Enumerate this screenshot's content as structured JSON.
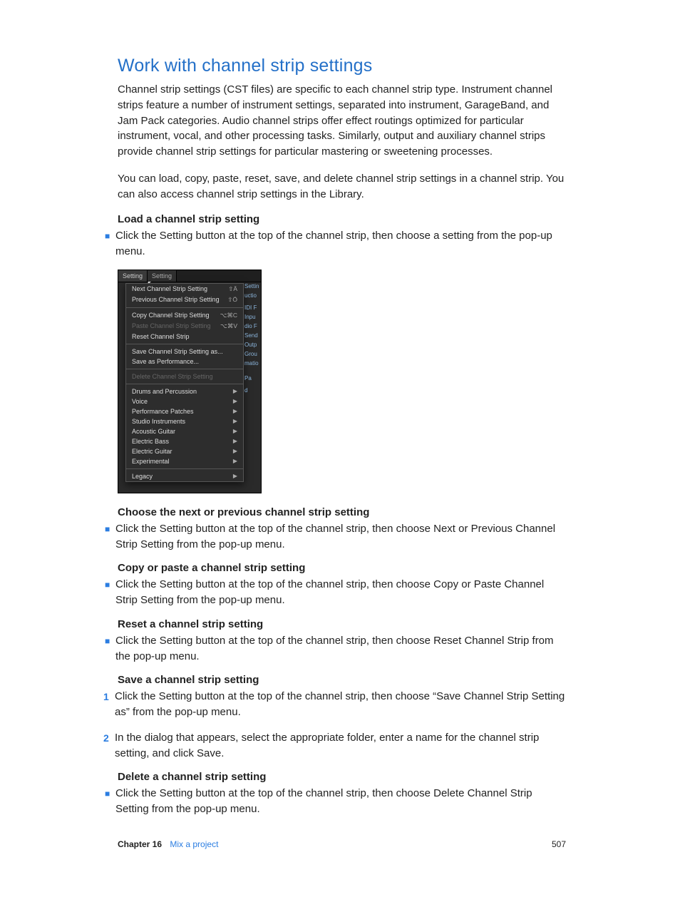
{
  "title": "Work with channel strip settings",
  "intro1": "Channel strip settings (CST files) are specific to each channel strip type. Instrument channel strips feature a number of instrument settings, separated into instrument, GarageBand, and Jam Pack categories. Audio channel strips offer effect routings optimized for particular instrument, vocal, and other processing tasks. Similarly, output and auxiliary channel strips provide channel strip settings for particular mastering or sweetening processes.",
  "intro2": "You can load, copy, paste, reset, save, and delete channel strip settings in a channel strip. You can also access channel strip settings in the Library.",
  "sections": {
    "load": {
      "heading": "Load a channel strip setting",
      "bullet": "Click the Setting button at the top of the channel strip, then choose a setting from the pop-up menu."
    },
    "nextprev": {
      "heading": "Choose the next or previous channel strip setting",
      "bullet": "Click the Setting button at the top of the channel strip, then choose Next or Previous Channel Strip Setting from the pop-up menu."
    },
    "copy": {
      "heading": "Copy or paste a channel strip setting",
      "bullet": "Click the Setting button at the top of the channel strip, then choose Copy or Paste Channel Strip Setting from the pop-up menu."
    },
    "reset": {
      "heading": "Reset a channel strip setting",
      "bullet": "Click the Setting button at the top of the channel strip, then choose Reset Channel Strip from the pop-up menu."
    },
    "save": {
      "heading": "Save a channel strip setting",
      "step1": "Click the Setting button at the top of the channel strip, then choose “Save Channel Strip Setting as” from the pop-up menu.",
      "step2": "In the dialog that appears, select the appropriate folder, enter a name for the channel strip setting, and click Save."
    },
    "delete": {
      "heading": "Delete a channel strip setting",
      "bullet": "Click the Setting button at the top of the channel strip, then choose Delete Channel Strip Setting from the pop-up menu."
    }
  },
  "menu": {
    "tabs": [
      "Setting",
      "Setting"
    ],
    "items": [
      {
        "label": "Next Channel Strip Setting",
        "sc": "⇧Ä"
      },
      {
        "label": "Previous Channel Strip Setting",
        "sc": "⇧Ö"
      },
      {
        "sep": true
      },
      {
        "label": "Copy Channel Strip Setting",
        "sc": "⌥⌘C"
      },
      {
        "label": "Paste Channel Strip Setting",
        "sc": "⌥⌘V",
        "dis": true
      },
      {
        "label": "Reset Channel Strip"
      },
      {
        "sep": true
      },
      {
        "label": "Save Channel Strip Setting as..."
      },
      {
        "label": "Save as Performance..."
      },
      {
        "sep": true
      },
      {
        "label": "Delete Channel Strip Setting",
        "dis": true
      },
      {
        "sep": true
      },
      {
        "label": "Drums and Percussion",
        "sub": true
      },
      {
        "label": "Voice",
        "sub": true
      },
      {
        "label": "Performance Patches",
        "sub": true
      },
      {
        "label": "Studio Instruments",
        "sub": true
      },
      {
        "label": "Acoustic Guitar",
        "sub": true
      },
      {
        "label": "Electric Bass",
        "sub": true
      },
      {
        "label": "Electric Guitar",
        "sub": true
      },
      {
        "label": "Experimental",
        "sub": true
      },
      {
        "sep": true
      },
      {
        "label": "Legacy",
        "sub": true
      }
    ],
    "side": [
      "Settin",
      "uctio",
      "",
      "IDI F",
      "Inpu",
      "dio F",
      "Send",
      "Outp",
      "Grou",
      "matio",
      "",
      "",
      "Pa",
      "",
      "d"
    ]
  },
  "footer": {
    "chapter": "Chapter  16",
    "title": "Mix a project",
    "page": "507"
  }
}
